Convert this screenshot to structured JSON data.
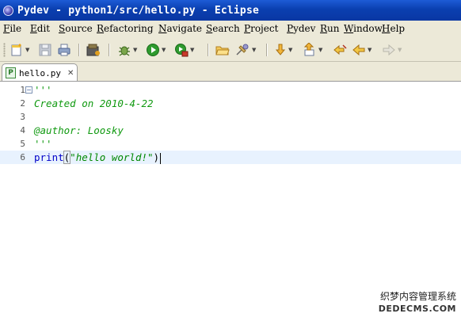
{
  "window": {
    "title": "Pydev - python1/src/hello.py - Eclipse"
  },
  "menu": [
    "File",
    "Edit",
    "Source",
    "Refactoring",
    "Navigate",
    "Search",
    "Project",
    "Pydev",
    "Run",
    "Window",
    "Help"
  ],
  "toolbar": {
    "icons": [
      "new-wizard-icon",
      "save-icon",
      "print-icon",
      "package-icon",
      "debug-icon",
      "run-icon",
      "external-tools-icon",
      "open-folder-icon",
      "pin-icon",
      "next-annotation-icon",
      "previous-annotation-icon",
      "last-edit-icon",
      "back-icon",
      "forward-icon"
    ]
  },
  "editor_tab": {
    "label": "hello.py",
    "icon": "P",
    "close": "✕"
  },
  "code_lines": [
    {
      "n": "1",
      "text": "'''"
    },
    {
      "n": "2",
      "text": "Created on 2010-4-22"
    },
    {
      "n": "3",
      "text": ""
    },
    {
      "n": "4",
      "text": "@author: Loosky"
    },
    {
      "n": "5",
      "text": "'''"
    },
    {
      "n": "6",
      "keyword": "print",
      "paren_open": "(",
      "string": "\"hello world!\"",
      "paren_close": ")"
    }
  ],
  "watermark": {
    "cn": "织梦内容管理系统",
    "en": "DEDECMS.COM"
  }
}
